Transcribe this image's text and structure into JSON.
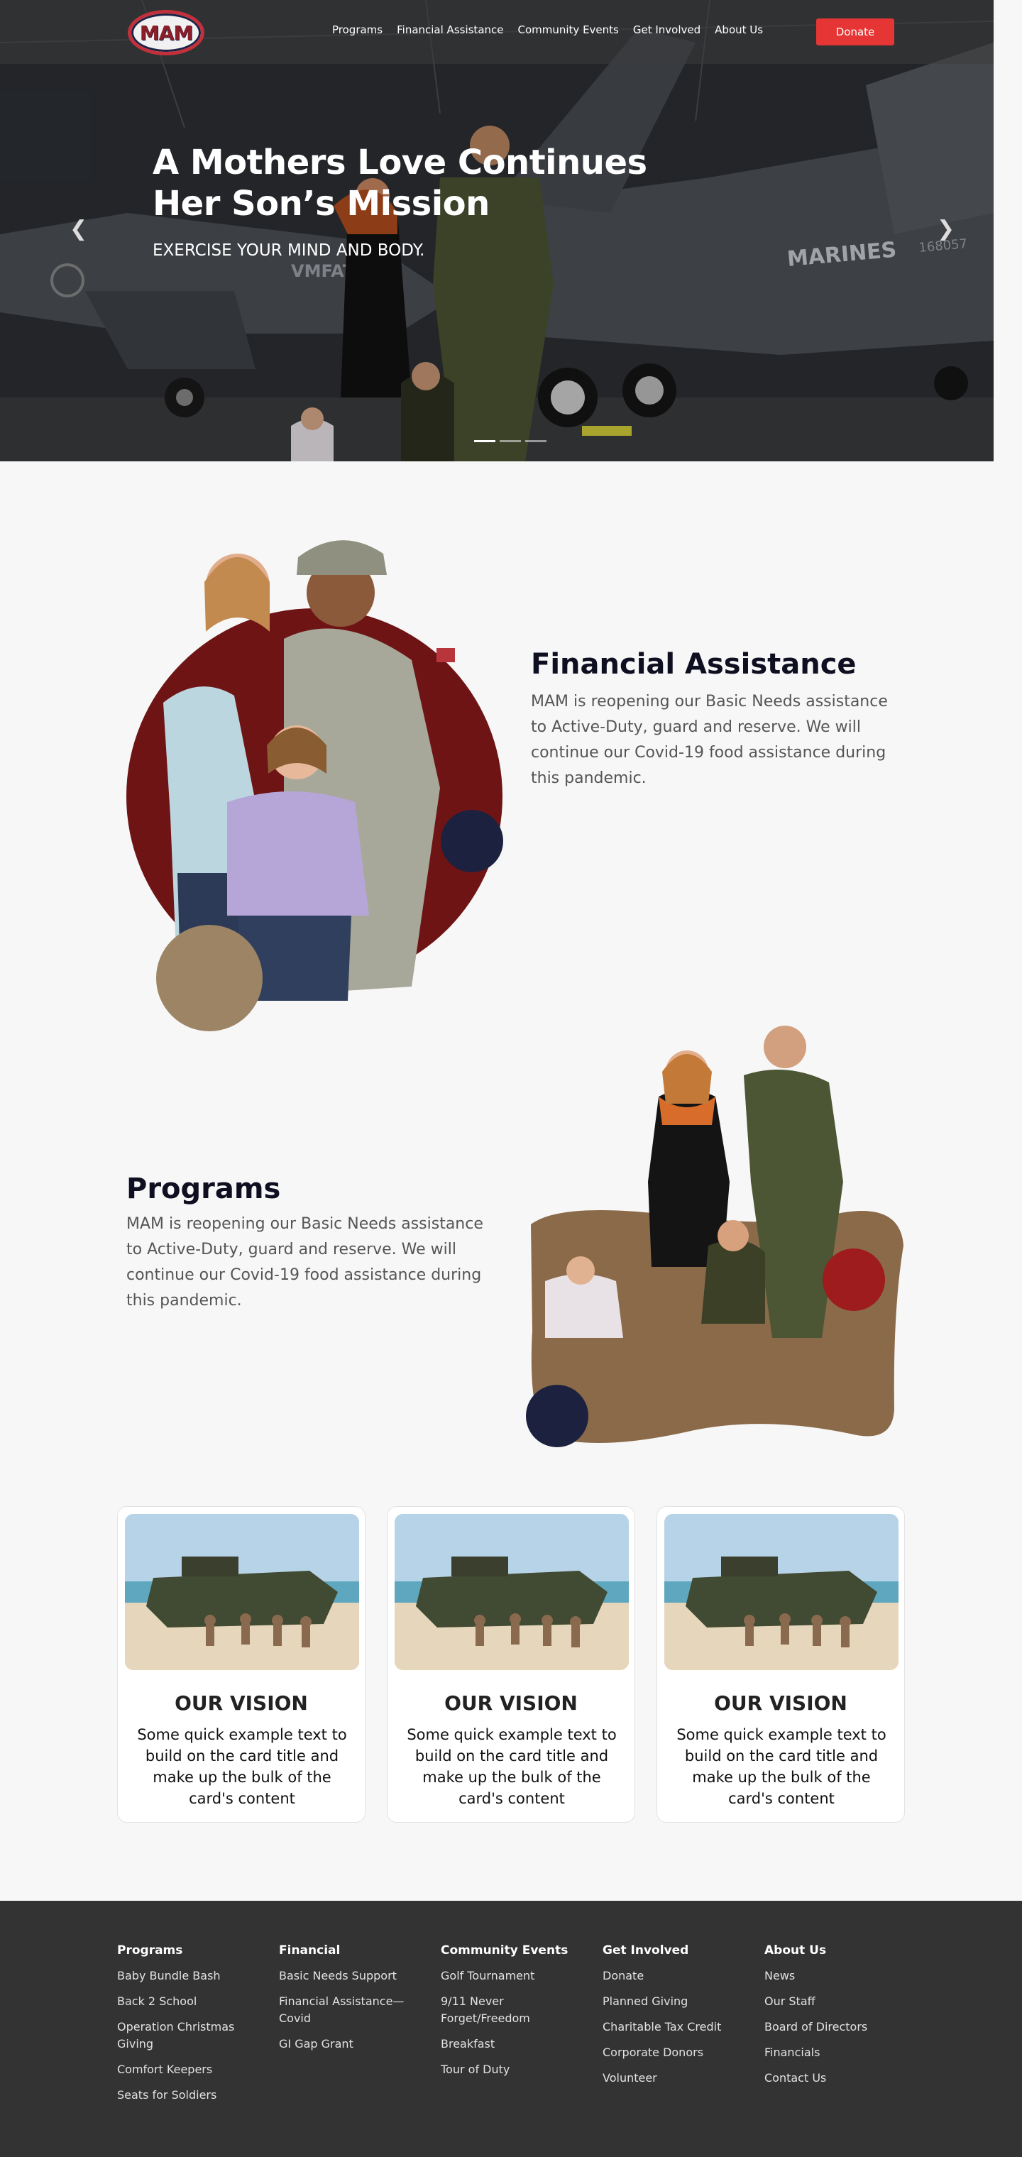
{
  "nav": {
    "logo_text": "MAM",
    "links": [
      "Programs",
      "Financial Assistance",
      "Community Events",
      "Get Involved",
      "About Us"
    ],
    "donate_label": "Donate"
  },
  "hero": {
    "title_line1": "A Mothers Love Continues",
    "title_line2": "Her Son’s Mission",
    "subtitle": "EXERCISE YOUR MIND AND BODY.",
    "aircraft_text_1": "MARINES",
    "aircraft_text_2": "VMFAT-",
    "aircraft_text_3": "168057",
    "slide_count": 3,
    "active_slide": 1
  },
  "financial": {
    "title": "Financial Assistance",
    "text": "MAM is reopening our Basic Needs assistance to Active-Duty, guard and reserve. We will continue our Covid-19 food assistance during this pandemic."
  },
  "programs": {
    "title": "Programs",
    "text": "MAM is reopening our Basic Needs assistance to Active-Duty, guard and reserve. We will continue our Covid-19 food assistance during this pandemic."
  },
  "cards": [
    {
      "title": "OUR VISION",
      "text": "Some quick example text to build on the card title and make up the bulk of the card's content"
    },
    {
      "title": "OUR VISION",
      "text": "Some quick example text to build on the card title and make up the bulk of the card's content"
    },
    {
      "title": "OUR VISION",
      "text": "Some quick example text to build on the card title and make up the bulk of the card's content"
    }
  ],
  "footer": {
    "columns": [
      {
        "heading": "Programs",
        "links": [
          "Baby Bundle Bash",
          "Back 2 School",
          "Operation Christmas Giving",
          "Comfort Keepers",
          "Seats for Soldiers"
        ]
      },
      {
        "heading": "Financial",
        "links": [
          "Basic Needs Support",
          "Financial Assistance—Covid",
          "GI Gap Grant"
        ]
      },
      {
        "heading": "Community Events",
        "links": [
          "Golf Tournament",
          "9/11 Never Forget/Freedom",
          "Breakfast",
          "Tour of Duty"
        ]
      },
      {
        "heading": "Get Involved",
        "links": [
          "Donate",
          "Planned Giving",
          "Charitable Tax Credit",
          "Corporate Donors",
          "Volunteer"
        ]
      },
      {
        "heading": "About Us",
        "links": [
          "News",
          "Our Staff",
          "Board of Directors",
          "Financials",
          "Contact Us"
        ]
      }
    ]
  },
  "colors": {
    "accent_red": "#e53535",
    "maroon": "#6e1414",
    "navy": "#1d2140",
    "tan": "#9c8465",
    "brown_blob": "#8a6a48",
    "footer_bg": "#333333"
  },
  "icons": {
    "prev": "chevron-left-icon",
    "next": "chevron-right-icon"
  }
}
